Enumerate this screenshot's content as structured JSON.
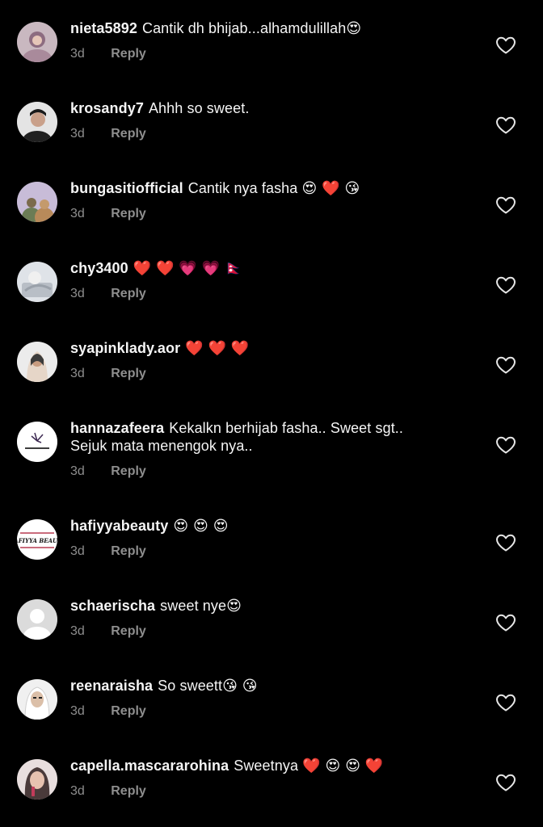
{
  "comments": [
    {
      "username": "nieta5892",
      "text": "Cantik dh bhijab...alhamdulillah",
      "emoji": "😍",
      "time": "3d",
      "reply": "Reply",
      "avatar_color": "#b69aa6",
      "heart_icon": "heart-outline-icon"
    },
    {
      "username": "krosandy7",
      "text": "Ahhh so sweet.",
      "emoji": "",
      "time": "3d",
      "reply": "Reply",
      "avatar_color": "#d9d9d9",
      "heart_icon": "heart-outline-icon"
    },
    {
      "username": "bungasitiofficial",
      "text": "Cantik nya fasha",
      "emoji": "😍 ❤️ 😘",
      "time": "3d",
      "reply": "Reply",
      "avatar_color": "#b3a7c8",
      "heart_icon": "heart-outline-icon"
    },
    {
      "username": "chy3400",
      "text": "",
      "emoji": "❤️ ❤️ 💗 💗 🇳🇵",
      "time": "3d",
      "reply": "Reply",
      "avatar_color": "#d0d5db",
      "heart_icon": "heart-outline-icon"
    },
    {
      "username": "syapinklady.aor",
      "text": "",
      "emoji": "❤️ ❤️ ❤️",
      "time": "3d",
      "reply": "Reply",
      "avatar_color": "#c9b2a3",
      "heart_icon": "heart-outline-icon"
    },
    {
      "username": "hannazafeera",
      "text": "Kekalkn berhijab fasha.. Sweet sgt..",
      "text2": "Sejuk mata menengok nya..",
      "emoji": "",
      "time": "3d",
      "reply": "Reply",
      "avatar_color": "#ffffff",
      "heart_icon": "heart-outline-icon"
    },
    {
      "username": "hafiyyabeauty",
      "text": "",
      "emoji": "😍 😍 😍",
      "time": "3d",
      "reply": "Reply",
      "avatar_color": "#ffffff",
      "avatar_label": "HAFIYYA BEAUTY",
      "heart_icon": "heart-outline-icon"
    },
    {
      "username": "schaerischa",
      "text": "sweet nye",
      "emoji": "😍",
      "time": "3d",
      "reply": "Reply",
      "avatar_color": "#dbdbdb",
      "heart_icon": "heart-outline-icon"
    },
    {
      "username": "reenaraisha",
      "text": "So sweett",
      "emoji": "😘 😘",
      "time": "3d",
      "reply": "Reply",
      "avatar_color": "#e6e6e6",
      "heart_icon": "heart-outline-icon"
    },
    {
      "username": "capella.mascararohina",
      "text": "Sweetnya",
      "emoji": "❤️ 😍 😍 ❤️",
      "time": "3d",
      "reply": "Reply",
      "avatar_color": "#d6c3c3",
      "heart_icon": "heart-outline-icon"
    }
  ],
  "colors": {
    "background": "#000000",
    "text": "#f5f5f5",
    "meta": "#8e8e8e"
  }
}
